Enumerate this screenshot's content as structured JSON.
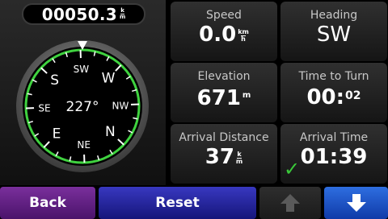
{
  "odometer": {
    "value": "00050.3",
    "unit_top": "k",
    "unit_bottom": "m"
  },
  "compass": {
    "heading_degrees": 227,
    "center_text": "227°",
    "labels": [
      {
        "text": "SW",
        "bearing": 225
      },
      {
        "text": "W",
        "bearing": 270
      },
      {
        "text": "NW",
        "bearing": 315
      },
      {
        "text": "N",
        "bearing": 0
      },
      {
        "text": "NE",
        "bearing": 45
      },
      {
        "text": "E",
        "bearing": 90
      },
      {
        "text": "SE",
        "bearing": 135
      },
      {
        "text": "S",
        "bearing": 180
      }
    ],
    "ring_color": "#3fd23f"
  },
  "fields": {
    "speed": {
      "label": "Speed",
      "value": "0.0",
      "unit_top": "km",
      "unit_bottom": "h"
    },
    "heading": {
      "label": "Heading",
      "value": "SW"
    },
    "elevation": {
      "label": "Elevation",
      "value": "671",
      "unit": "m"
    },
    "time_to_turn": {
      "label": "Time to Turn",
      "value": "00:",
      "value_small": "02"
    },
    "arrival_distance": {
      "label": "Arrival Distance",
      "value": "37",
      "unit_top": "k",
      "unit_bottom": "m"
    },
    "arrival_time": {
      "label": "Arrival Time",
      "value": "01:39",
      "status_icon": "checkmark-icon"
    }
  },
  "buttons": {
    "back": "Back",
    "reset": "Reset",
    "up_icon": "arrow-up-icon",
    "down_icon": "arrow-down-icon"
  },
  "colors": {
    "back": "#5a1f7e",
    "reset": "#25259a",
    "down": "#1d52c8",
    "accent_green": "#3fd23f"
  }
}
